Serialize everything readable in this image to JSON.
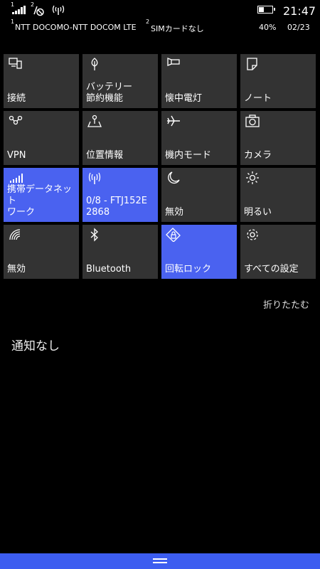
{
  "status_bar": {
    "sim1_badge": "1",
    "sim2_badge": "2",
    "battery_percent": "40%",
    "battery_level": 0.4,
    "time": "21:47",
    "date": "02/23",
    "carrier1_badge": "1",
    "carrier1": "NTT DOCOMO-NTT DOCOM LTE",
    "carrier2_badge": "2",
    "carrier2": "SIMカードなし"
  },
  "tiles": [
    {
      "label": "接続",
      "icon": "project-icon",
      "active": false
    },
    {
      "label": "バッテリー\n節約機能",
      "icon": "battery-saver-icon",
      "active": false
    },
    {
      "label": "懐中電灯",
      "icon": "flashlight-icon",
      "active": false
    },
    {
      "label": "ノート",
      "icon": "note-icon",
      "active": false
    },
    {
      "label": "VPN",
      "icon": "vpn-icon",
      "active": false
    },
    {
      "label": "位置情報",
      "icon": "location-icon",
      "active": false
    },
    {
      "label": "機内モード",
      "icon": "airplane-icon",
      "active": false
    },
    {
      "label": "カメラ",
      "icon": "camera-icon",
      "active": false
    },
    {
      "label": "携帯データネット\nワーク",
      "icon": "cellular-data-icon",
      "active": true
    },
    {
      "label": "0/8 - FTJ152E\n2868",
      "icon": "hotspot-icon",
      "active": true
    },
    {
      "label": "無効",
      "icon": "moon-icon",
      "active": false
    },
    {
      "label": "明るい",
      "icon": "brightness-icon",
      "active": false
    },
    {
      "label": "無効",
      "icon": "wifi-icon",
      "active": false
    },
    {
      "label": "Bluetooth",
      "icon": "bluetooth-icon",
      "active": false
    },
    {
      "label": "回転ロック",
      "icon": "rotation-lock-icon",
      "active": true
    },
    {
      "label": "すべての設定",
      "icon": "gear-icon",
      "active": false
    }
  ],
  "collapse_label": "折りたたむ",
  "notifications_empty": "通知なし",
  "colors": {
    "accent": "#4a62f0",
    "tile": "#333333",
    "background": "#000000"
  }
}
